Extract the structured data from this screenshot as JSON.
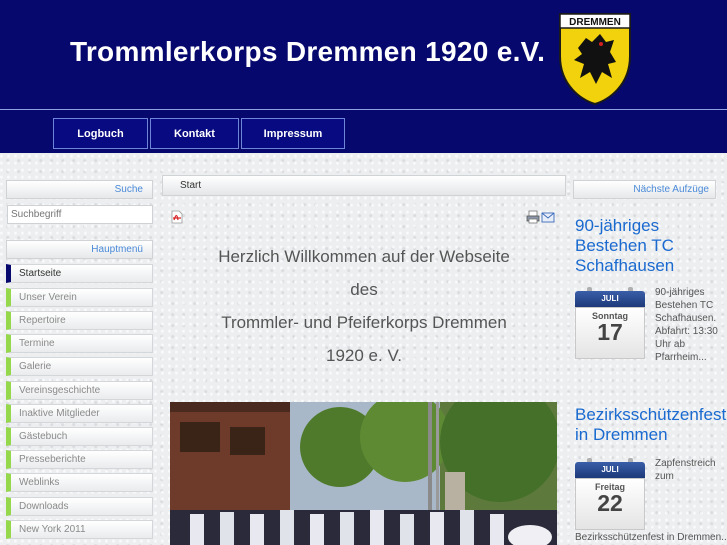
{
  "header": {
    "title": "Trommlerkorps Dremmen 1920 e.V.",
    "logo_text": "DREMMEN"
  },
  "nav": {
    "items": [
      "Logbuch",
      "Kontakt",
      "Impressum"
    ]
  },
  "search": {
    "heading": "Suche",
    "placeholder": "Suchbegriff"
  },
  "main_menu": {
    "heading": "Hauptmenü",
    "items": [
      "Startseite",
      "Unser Verein",
      "Repertoire",
      "Termine",
      "Galerie",
      "Vereinsgeschichte",
      "Inaktive Mitglieder",
      "Gästebuch",
      "Presseberichte",
      "Weblinks",
      "Downloads",
      "New York 2011"
    ]
  },
  "breadcrumb": "Start",
  "welcome": {
    "line1": "Herzlich Willkommen auf der Webseite",
    "line2": "des",
    "line3": "Trommler- und Pfeiferkorps Dremmen",
    "line4": "1920 e. V."
  },
  "sidebar_right": {
    "heading": "Nächste Aufzüge",
    "events": [
      {
        "title_line1": "90-jähriges",
        "title_line2": "Bestehen TC",
        "title_line3": "Schafhausen",
        "month": "JULI",
        "weekday": "Sonntag",
        "day": "17",
        "desc": [
          "90-jähriges",
          "Bestehen TC",
          "Schafhausen.",
          "Abfahrt: 13:30",
          "Uhr ab",
          "Pfarrheim..."
        ]
      },
      {
        "title_line1": "Bezirksschützenfest",
        "title_line2": "in Dremmen",
        "month": "JULI",
        "weekday": "Freitag",
        "day": "22",
        "desc": [
          "Zapfenstreich",
          "zum"
        ],
        "footer": "Bezirksschützenfest in Dremmen..."
      }
    ]
  },
  "colors": {
    "header_bg": "#06086e",
    "link_blue": "#1a6ad0",
    "menu_marker": "#96d84c"
  }
}
